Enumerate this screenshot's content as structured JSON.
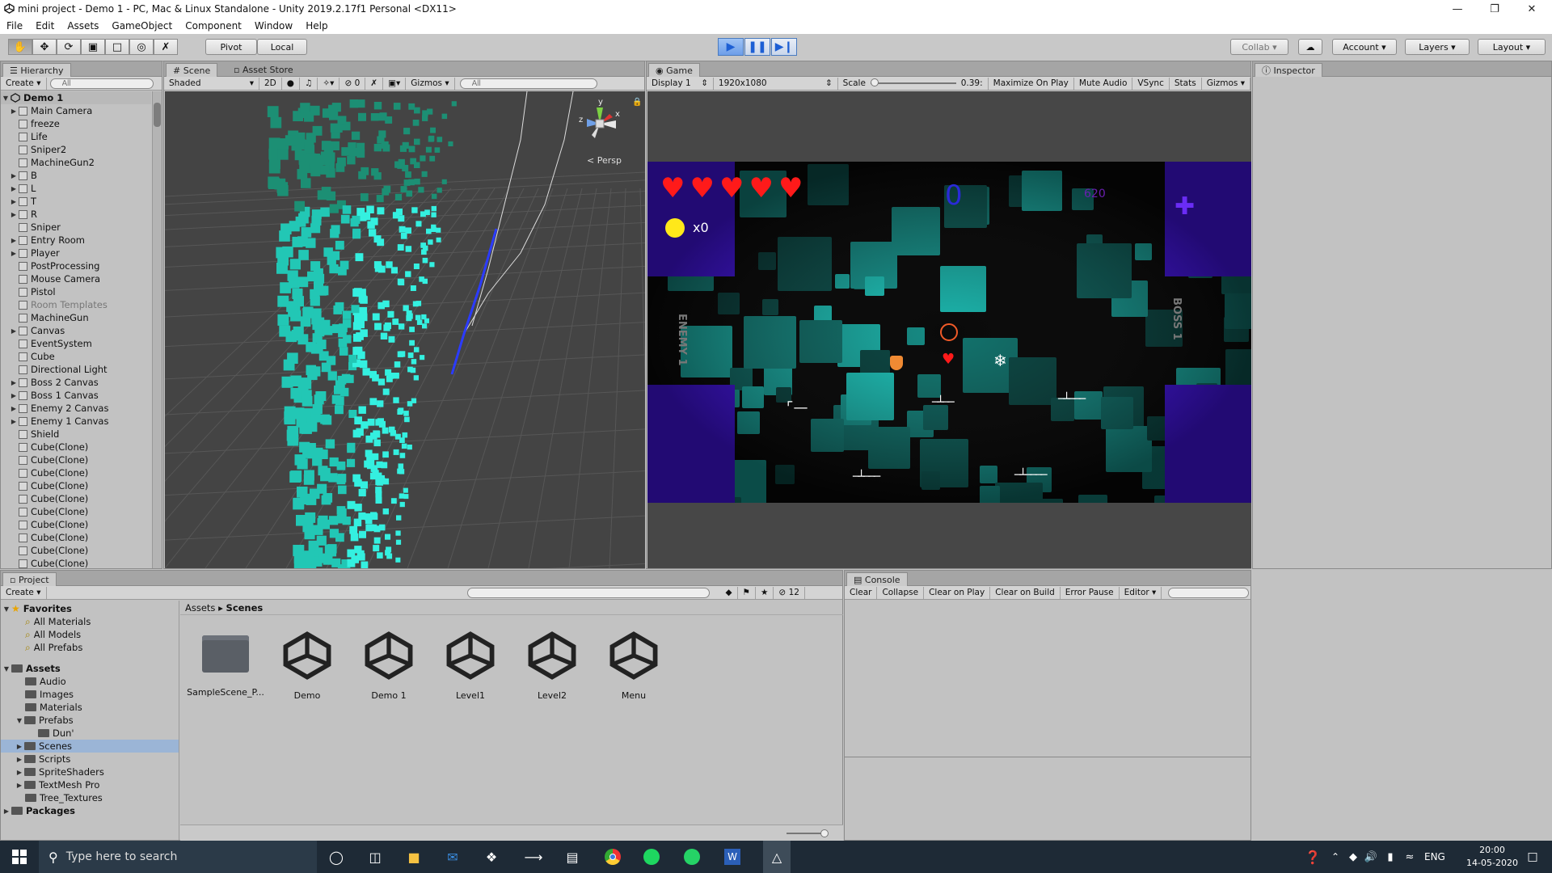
{
  "window": {
    "title": "mini project - Demo 1 - PC, Mac & Linux Standalone - Unity 2019.2.17f1 Personal <DX11>"
  },
  "menu": [
    "File",
    "Edit",
    "Assets",
    "GameObject",
    "Component",
    "Window",
    "Help"
  ],
  "toolbar": {
    "pivot": "Pivot",
    "local": "Local",
    "collab": "Collab",
    "account": "Account",
    "layers": "Layers",
    "layout": "Layout"
  },
  "hierarchy": {
    "tab": "Hierarchy",
    "create": "Create",
    "search_placeholder": "All",
    "scene_name": "Demo 1",
    "items": [
      {
        "label": "Main Camera",
        "expand": true
      },
      {
        "label": "freeze",
        "expand": false
      },
      {
        "label": "Life",
        "expand": false
      },
      {
        "label": "Sniper2",
        "expand": false
      },
      {
        "label": "MachineGun2",
        "expand": false
      },
      {
        "label": "B",
        "expand": true
      },
      {
        "label": "L",
        "expand": true
      },
      {
        "label": "T",
        "expand": true
      },
      {
        "label": "R",
        "expand": true
      },
      {
        "label": "Sniper",
        "expand": false
      },
      {
        "label": "Entry Room",
        "expand": true
      },
      {
        "label": "Player",
        "expand": true
      },
      {
        "label": "PostProcessing",
        "expand": false
      },
      {
        "label": "Mouse Camera",
        "expand": false
      },
      {
        "label": "Pistol",
        "expand": false
      },
      {
        "label": "Room Templates",
        "expand": false,
        "dim": true
      },
      {
        "label": "MachineGun",
        "expand": false
      },
      {
        "label": "Canvas",
        "expand": true
      },
      {
        "label": "EventSystem",
        "expand": false
      },
      {
        "label": "Cube",
        "expand": false
      },
      {
        "label": "Directional Light",
        "expand": false
      },
      {
        "label": "Boss 2 Canvas",
        "expand": true
      },
      {
        "label": "Boss 1 Canvas",
        "expand": true
      },
      {
        "label": "Enemy 2 Canvas",
        "expand": true
      },
      {
        "label": "Enemy 1 Canvas",
        "expand": true
      },
      {
        "label": "Shield",
        "expand": false
      },
      {
        "label": "Cube(Clone)",
        "expand": false
      },
      {
        "label": "Cube(Clone)",
        "expand": false
      },
      {
        "label": "Cube(Clone)",
        "expand": false
      },
      {
        "label": "Cube(Clone)",
        "expand": false
      },
      {
        "label": "Cube(Clone)",
        "expand": false
      },
      {
        "label": "Cube(Clone)",
        "expand": false
      },
      {
        "label": "Cube(Clone)",
        "expand": false
      },
      {
        "label": "Cube(Clone)",
        "expand": false
      },
      {
        "label": "Cube(Clone)",
        "expand": false
      },
      {
        "label": "Cube(Clone)",
        "expand": false
      }
    ]
  },
  "scene": {
    "tabs": [
      "Scene",
      "Asset Store"
    ],
    "shading": "Shaded",
    "mode2d": "2D",
    "fx_count": "0",
    "gizmos": "Gizmos",
    "search_placeholder": "All",
    "persp": "Persp",
    "axes": {
      "y": "y",
      "z": "z",
      "x": "x"
    }
  },
  "game": {
    "tab": "Game",
    "display": "Display 1",
    "resolution": "1920x1080",
    "scale_label": "Scale",
    "scale_value": "0.39:",
    "maximize": "Maximize On Play",
    "mute": "Mute Audio",
    "vsync": "VSync",
    "stats": "Stats",
    "gizmos": "Gizmos",
    "hud": {
      "hearts": 5,
      "coins": "x0",
      "counter": "0",
      "score": "620",
      "enemy_label": "ENEMY 1",
      "boss_label": "BOSS 1"
    }
  },
  "inspector": {
    "tab": "Inspector"
  },
  "project": {
    "tab": "Project",
    "create": "Create",
    "filter_count": "12",
    "favorites": {
      "title": "Favorites",
      "items": [
        "All Materials",
        "All Models",
        "All Prefabs"
      ]
    },
    "assets": {
      "title": "Assets",
      "items": [
        "Audio",
        "Images",
        "Materials",
        "Prefabs",
        "Dun'",
        "Scenes",
        "Scripts",
        "SpriteShaders",
        "TextMesh Pro",
        "Tree_Textures"
      ]
    },
    "packages": "Packages",
    "breadcrumb": [
      "Assets",
      "Scenes"
    ],
    "files": [
      {
        "name": "SampleScene_P...",
        "type": "folder"
      },
      {
        "name": "Demo",
        "type": "unity"
      },
      {
        "name": "Demo 1",
        "type": "unity"
      },
      {
        "name": "Level1",
        "type": "unity"
      },
      {
        "name": "Level2",
        "type": "unity"
      },
      {
        "name": "Menu",
        "type": "unity"
      }
    ]
  },
  "console": {
    "tab": "Console",
    "buttons": [
      "Clear",
      "Collapse",
      "Clear on Play",
      "Clear on Build",
      "Error Pause",
      "Editor"
    ]
  },
  "taskbar": {
    "search_placeholder": "Type here to search",
    "lang": "ENG",
    "time": "20:00",
    "date": "14-05-2020"
  },
  "colors": {
    "accent": "#3b78e7",
    "cube": "#2ee0d0",
    "room_wall": "#4b16ff",
    "heart": "#ff1a1a",
    "coin": "#ffe81a"
  }
}
